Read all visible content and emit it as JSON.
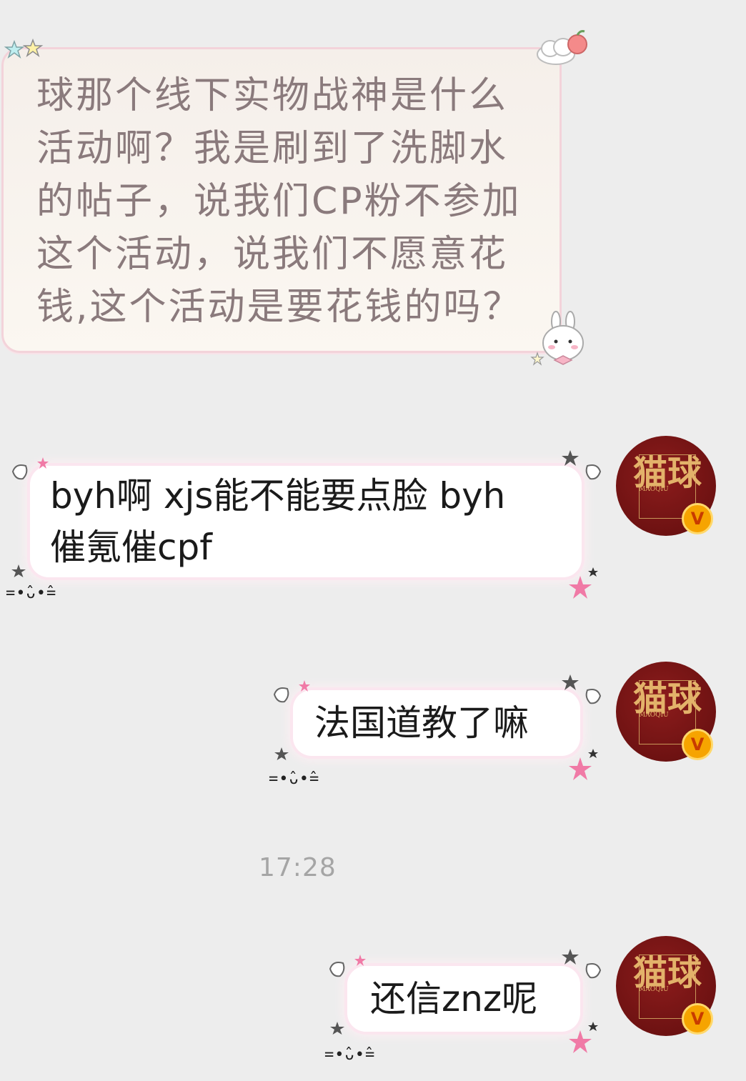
{
  "messages": [
    {
      "side": "incoming",
      "text": "球那个线下实物战神是什么\n活动啊？我是刷到了洗脚水\n的帖子，说我们CP粉不参加\n这个活动，说我们不愿意花\n钱,这个活动是要花钱的吗？"
    },
    {
      "side": "outgoing",
      "text": "byh啊 xjs能不能要点脸 byh\n催氪催cpf"
    },
    {
      "side": "outgoing",
      "text": "法国道教了嘛"
    },
    {
      "side": "outgoing",
      "text": "还信znz呢"
    }
  ],
  "timestamp": "17:28",
  "avatar": {
    "glyph": "猫球",
    "small_text": "MAOQIU",
    "badge": "V"
  },
  "decor": {
    "face": "=•̂ᴗ•̂=",
    "accent_pink": "#f07aa6",
    "accent_gray": "#555555"
  }
}
